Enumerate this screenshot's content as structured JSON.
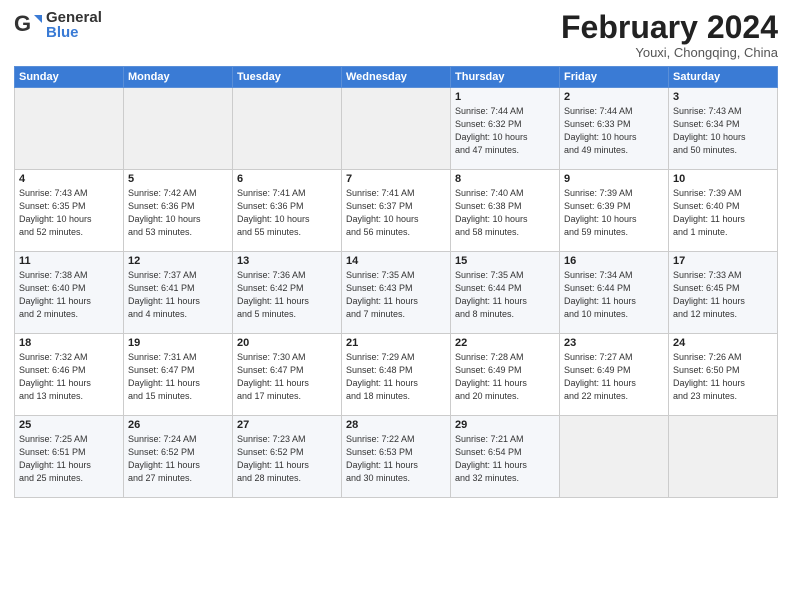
{
  "logo": {
    "general": "General",
    "blue": "Blue"
  },
  "title": "February 2024",
  "subtitle": "Youxi, Chongqing, China",
  "days_of_week": [
    "Sunday",
    "Monday",
    "Tuesday",
    "Wednesday",
    "Thursday",
    "Friday",
    "Saturday"
  ],
  "weeks": [
    [
      {
        "day": "",
        "info": ""
      },
      {
        "day": "",
        "info": ""
      },
      {
        "day": "",
        "info": ""
      },
      {
        "day": "",
        "info": ""
      },
      {
        "day": "1",
        "info": "Sunrise: 7:44 AM\nSunset: 6:32 PM\nDaylight: 10 hours\nand 47 minutes."
      },
      {
        "day": "2",
        "info": "Sunrise: 7:44 AM\nSunset: 6:33 PM\nDaylight: 10 hours\nand 49 minutes."
      },
      {
        "day": "3",
        "info": "Sunrise: 7:43 AM\nSunset: 6:34 PM\nDaylight: 10 hours\nand 50 minutes."
      }
    ],
    [
      {
        "day": "4",
        "info": "Sunrise: 7:43 AM\nSunset: 6:35 PM\nDaylight: 10 hours\nand 52 minutes."
      },
      {
        "day": "5",
        "info": "Sunrise: 7:42 AM\nSunset: 6:36 PM\nDaylight: 10 hours\nand 53 minutes."
      },
      {
        "day": "6",
        "info": "Sunrise: 7:41 AM\nSunset: 6:36 PM\nDaylight: 10 hours\nand 55 minutes."
      },
      {
        "day": "7",
        "info": "Sunrise: 7:41 AM\nSunset: 6:37 PM\nDaylight: 10 hours\nand 56 minutes."
      },
      {
        "day": "8",
        "info": "Sunrise: 7:40 AM\nSunset: 6:38 PM\nDaylight: 10 hours\nand 58 minutes."
      },
      {
        "day": "9",
        "info": "Sunrise: 7:39 AM\nSunset: 6:39 PM\nDaylight: 10 hours\nand 59 minutes."
      },
      {
        "day": "10",
        "info": "Sunrise: 7:39 AM\nSunset: 6:40 PM\nDaylight: 11 hours\nand 1 minute."
      }
    ],
    [
      {
        "day": "11",
        "info": "Sunrise: 7:38 AM\nSunset: 6:40 PM\nDaylight: 11 hours\nand 2 minutes."
      },
      {
        "day": "12",
        "info": "Sunrise: 7:37 AM\nSunset: 6:41 PM\nDaylight: 11 hours\nand 4 minutes."
      },
      {
        "day": "13",
        "info": "Sunrise: 7:36 AM\nSunset: 6:42 PM\nDaylight: 11 hours\nand 5 minutes."
      },
      {
        "day": "14",
        "info": "Sunrise: 7:35 AM\nSunset: 6:43 PM\nDaylight: 11 hours\nand 7 minutes."
      },
      {
        "day": "15",
        "info": "Sunrise: 7:35 AM\nSunset: 6:44 PM\nDaylight: 11 hours\nand 8 minutes."
      },
      {
        "day": "16",
        "info": "Sunrise: 7:34 AM\nSunset: 6:44 PM\nDaylight: 11 hours\nand 10 minutes."
      },
      {
        "day": "17",
        "info": "Sunrise: 7:33 AM\nSunset: 6:45 PM\nDaylight: 11 hours\nand 12 minutes."
      }
    ],
    [
      {
        "day": "18",
        "info": "Sunrise: 7:32 AM\nSunset: 6:46 PM\nDaylight: 11 hours\nand 13 minutes."
      },
      {
        "day": "19",
        "info": "Sunrise: 7:31 AM\nSunset: 6:47 PM\nDaylight: 11 hours\nand 15 minutes."
      },
      {
        "day": "20",
        "info": "Sunrise: 7:30 AM\nSunset: 6:47 PM\nDaylight: 11 hours\nand 17 minutes."
      },
      {
        "day": "21",
        "info": "Sunrise: 7:29 AM\nSunset: 6:48 PM\nDaylight: 11 hours\nand 18 minutes."
      },
      {
        "day": "22",
        "info": "Sunrise: 7:28 AM\nSunset: 6:49 PM\nDaylight: 11 hours\nand 20 minutes."
      },
      {
        "day": "23",
        "info": "Sunrise: 7:27 AM\nSunset: 6:49 PM\nDaylight: 11 hours\nand 22 minutes."
      },
      {
        "day": "24",
        "info": "Sunrise: 7:26 AM\nSunset: 6:50 PM\nDaylight: 11 hours\nand 23 minutes."
      }
    ],
    [
      {
        "day": "25",
        "info": "Sunrise: 7:25 AM\nSunset: 6:51 PM\nDaylight: 11 hours\nand 25 minutes."
      },
      {
        "day": "26",
        "info": "Sunrise: 7:24 AM\nSunset: 6:52 PM\nDaylight: 11 hours\nand 27 minutes."
      },
      {
        "day": "27",
        "info": "Sunrise: 7:23 AM\nSunset: 6:52 PM\nDaylight: 11 hours\nand 28 minutes."
      },
      {
        "day": "28",
        "info": "Sunrise: 7:22 AM\nSunset: 6:53 PM\nDaylight: 11 hours\nand 30 minutes."
      },
      {
        "day": "29",
        "info": "Sunrise: 7:21 AM\nSunset: 6:54 PM\nDaylight: 11 hours\nand 32 minutes."
      },
      {
        "day": "",
        "info": ""
      },
      {
        "day": "",
        "info": ""
      }
    ]
  ]
}
